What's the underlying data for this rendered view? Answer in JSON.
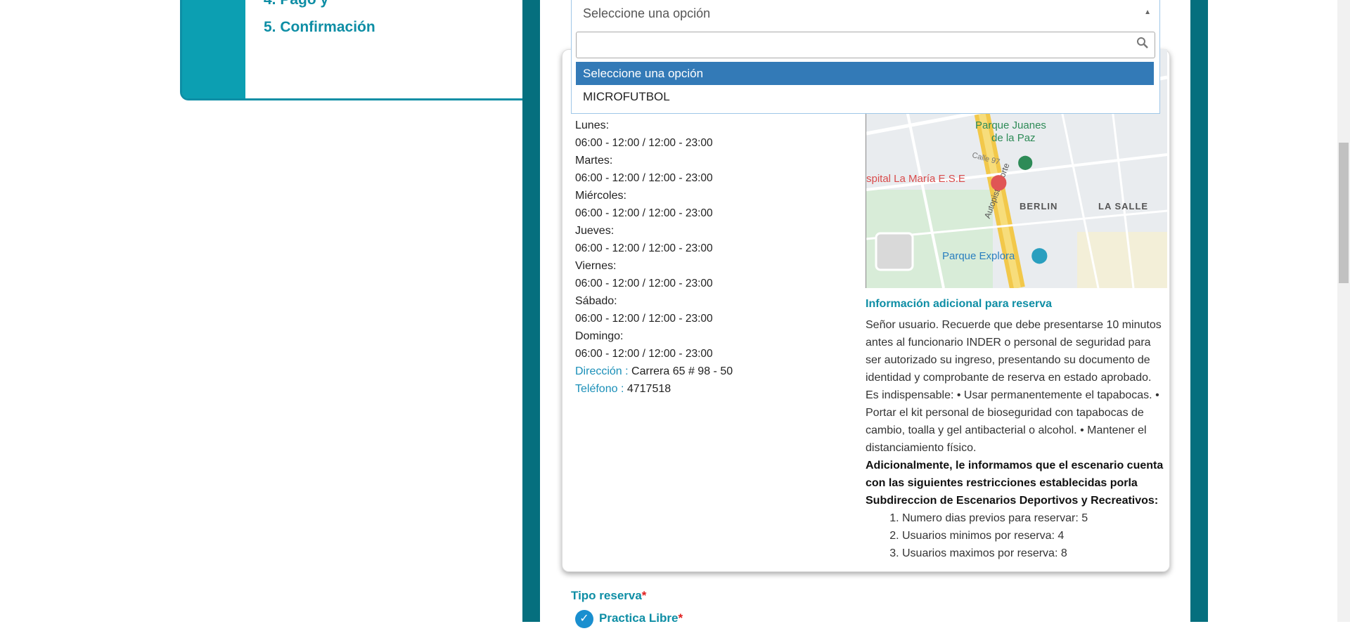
{
  "steps": {
    "partial_label": "4. Pago y",
    "confirm_label": "5. Confirmación"
  },
  "select": {
    "value": "Seleccione una opción",
    "search_placeholder": "",
    "options": [
      "Seleccione una opción",
      "MICROFUTBOL"
    ],
    "selected_index": 0
  },
  "schedule": {
    "days": [
      {
        "day": "Lunes:",
        "hours": "06:00 - 12:00  /  12:00 - 23:00"
      },
      {
        "day": "Martes:",
        "hours": "06:00 - 12:00  /  12:00 - 23:00"
      },
      {
        "day": "Miércoles:",
        "hours": "06:00 - 12:00  /  12:00 - 23:00"
      },
      {
        "day": "Jueves:",
        "hours": "06:00 - 12:00  /  12:00 - 23:00"
      },
      {
        "day": "Viernes:",
        "hours": "06:00 - 12:00  /  12:00 - 23:00"
      },
      {
        "day": "Sábado:",
        "hours": "06:00 - 12:00  /  12:00 - 23:00"
      },
      {
        "day": "Domingo:",
        "hours": "06:00 - 12:00  /  12:00 - 23:00"
      }
    ],
    "address_label": "Dirección :",
    "address_value": "Carrera 65 # 98 - 50",
    "phone_label": "Teléfono :",
    "phone_value": "4717518"
  },
  "map": {
    "labels": {
      "park1": "Parque Juanes",
      "park1b": "de la Paz",
      "hospital": "spital La María E.S.E",
      "berlin": "BERLIN",
      "lasalle": "LA SALLE",
      "explora": "Parque Explora",
      "autopista": "Autopista Norte",
      "calle97": "Calle 97"
    }
  },
  "info": {
    "title": "Información adicional para reserva",
    "body": "Señor usuario. Recuerde que debe presentarse 10 minutos antes al funcionario INDER o personal de seguridad para ser autorizado su ingreso, presentando su documento de identidad y comprobante de reserva en estado aprobado. Es indispensable: • Usar permanentemente el tapabocas. • Portar el kit personal de bioseguridad con tapabocas de cambio, toalla y gel antibacterial o alcohol. • Mantener el distanciamiento físico.",
    "bold_text": "Adicionalmente, le informamos que el escenario cuenta con las siguientes restricciones establecidas porla Subdireccion de Escenarios Deportivos y Recreativos:",
    "restrictions": [
      "Numero dias previos para reservar: 5",
      "Usuarios minimos por reserva: 4",
      "Usuarios maximos por reserva: 8"
    ]
  },
  "tipo_reserva": {
    "label": "Tipo reserva",
    "required_mark": "*",
    "option_label": "Practica Libre",
    "option_checked": true
  },
  "colors": {
    "teal_dark": "#056f7e",
    "teal": "#0e8ea5",
    "selected_blue": "#337ab7"
  }
}
